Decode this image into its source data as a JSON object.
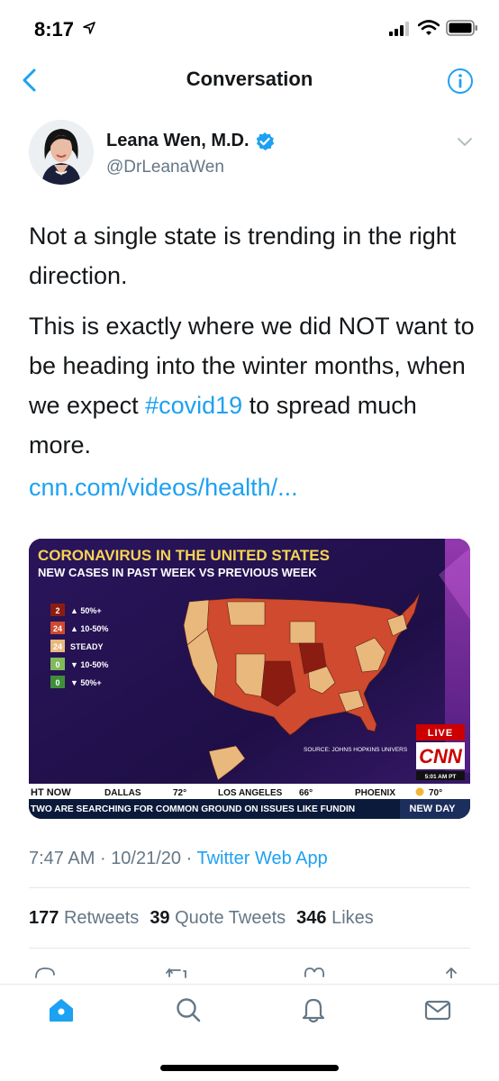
{
  "status_bar": {
    "time": "8:17"
  },
  "nav": {
    "title": "Conversation"
  },
  "author": {
    "name": "Leana Wen, M.D.",
    "handle": "@DrLeanaWen"
  },
  "tweet": {
    "paragraph1": "Not a single state is trending in the right direction.",
    "paragraph2_before": "This is exactly where we did NOT want to be heading into the winter months, when we expect ",
    "hashtag": "#covid19",
    "paragraph2_after": " to spread much more.",
    "link": "cnn.com/videos/health/..."
  },
  "media": {
    "title": "CORONAVIRUS IN THE UNITED STATES",
    "subtitle": "NEW CASES IN PAST WEEK VS PREVIOUS WEEK",
    "legend": [
      {
        "count": "2",
        "label": "▲ 50%+",
        "color": "#8b1c12"
      },
      {
        "count": "24",
        "label": "▲ 10-50%",
        "color": "#cf4a2e"
      },
      {
        "count": "24",
        "label": "STEADY",
        "color": "#e8b87d"
      },
      {
        "count": "0",
        "label": "▼ 10-50%",
        "color": "#7fb95a"
      },
      {
        "count": "0",
        "label": "▼ 50%+",
        "color": "#3f8f3a"
      }
    ],
    "source": "SOURCE: JOHNS HOPKINS UNIVERS",
    "live": "LIVE",
    "network": "CNN",
    "time": "5:01 AM PT",
    "ticker_weather": [
      {
        "text": "HT NOW"
      },
      {
        "city": "DALLAS",
        "temp": "72°"
      },
      {
        "city": "LOS ANGELES",
        "temp": "66°"
      },
      {
        "city": "PHOENIX",
        "temp": "70°"
      }
    ],
    "crawl": "TWO ARE SEARCHING FOR COMMON GROUND ON ISSUES LIKE FUNDIN",
    "show": "NEW DAY"
  },
  "meta": {
    "time": "7:47 AM",
    "date": "10/21/20",
    "source": "Twitter Web App",
    "separator": "·"
  },
  "stats": {
    "retweets_count": "177",
    "retweets_label": "Retweets",
    "quotes_count": "39",
    "quotes_label": "Quote Tweets",
    "likes_count": "346",
    "likes_label": "Likes"
  },
  "colors": {
    "accent": "#1da1f2",
    "text": "#14171a",
    "muted": "#657786"
  }
}
